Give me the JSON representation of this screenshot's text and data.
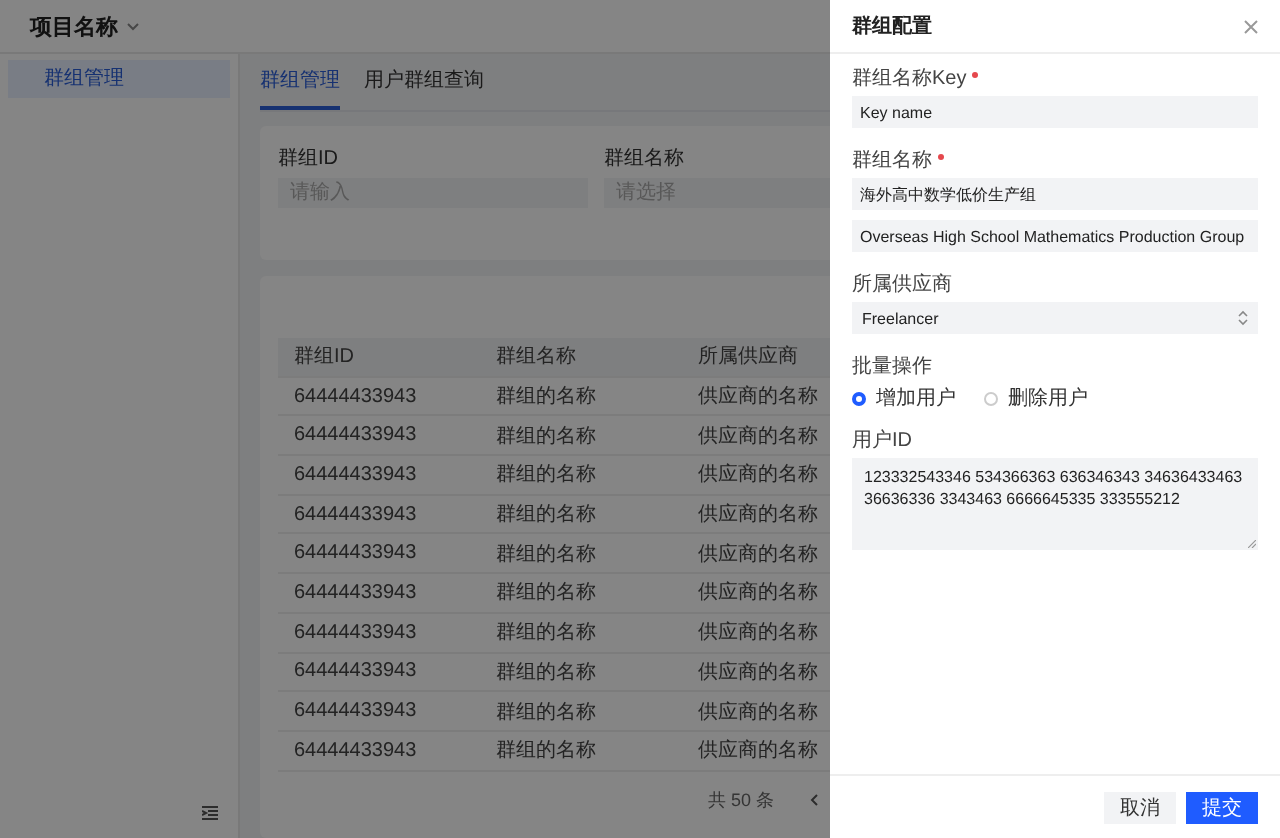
{
  "header": {
    "project": "项目名称"
  },
  "sidebar": {
    "items": [
      {
        "label": "群组管理",
        "selected": true
      }
    ]
  },
  "tabs": [
    {
      "label": "群组管理",
      "selected": true
    },
    {
      "label": "用户群组查询",
      "selected": false
    }
  ],
  "filters": [
    {
      "label": "群组ID",
      "placeholder": "请输入"
    },
    {
      "label": "群组名称",
      "placeholder": "请选择"
    }
  ],
  "table": {
    "columns": [
      "群组ID",
      "群组名称",
      "所属供应商"
    ],
    "rows": [
      [
        "64444433943",
        "群组的名称",
        "供应商的名称"
      ],
      [
        "64444433943",
        "群组的名称",
        "供应商的名称"
      ],
      [
        "64444433943",
        "群组的名称",
        "供应商的名称"
      ],
      [
        "64444433943",
        "群组的名称",
        "供应商的名称"
      ],
      [
        "64444433943",
        "群组的名称",
        "供应商的名称"
      ],
      [
        "64444433943",
        "群组的名称",
        "供应商的名称"
      ],
      [
        "64444433943",
        "群组的名称",
        "供应商的名称"
      ],
      [
        "64444433943",
        "群组的名称",
        "供应商的名称"
      ],
      [
        "64444433943",
        "群组的名称",
        "供应商的名称"
      ],
      [
        "64444433943",
        "群组的名称",
        "供应商的名称"
      ]
    ]
  },
  "pagination": {
    "total": "共 50 条"
  },
  "drawer": {
    "title": "群组配置",
    "fields": [
      {
        "kind": "input",
        "label": "群组名称Key",
        "required": true,
        "values": [
          "Key name"
        ]
      },
      {
        "kind": "input",
        "label": "群组名称",
        "required": true,
        "values": [
          "海外高中数学低价生产组",
          "Overseas High School Mathematics Production Group"
        ]
      },
      {
        "kind": "select",
        "label": "所属供应商",
        "required": false,
        "values": [
          "Freelancer"
        ]
      },
      {
        "kind": "radio",
        "label": "批量操作",
        "required": false,
        "options": [
          {
            "label": "增加用户",
            "selected": true
          },
          {
            "label": "删除用户",
            "selected": false
          }
        ]
      },
      {
        "kind": "textarea",
        "label": "用户ID",
        "required": false,
        "values": [
          "123332543346 534366363 636346343 34636433463 36636336 3343463 6666645335 333555212"
        ]
      }
    ],
    "buttons": [
      {
        "label": "取消",
        "kind": "secondary"
      },
      {
        "label": "提交",
        "kind": "primary"
      }
    ]
  }
}
